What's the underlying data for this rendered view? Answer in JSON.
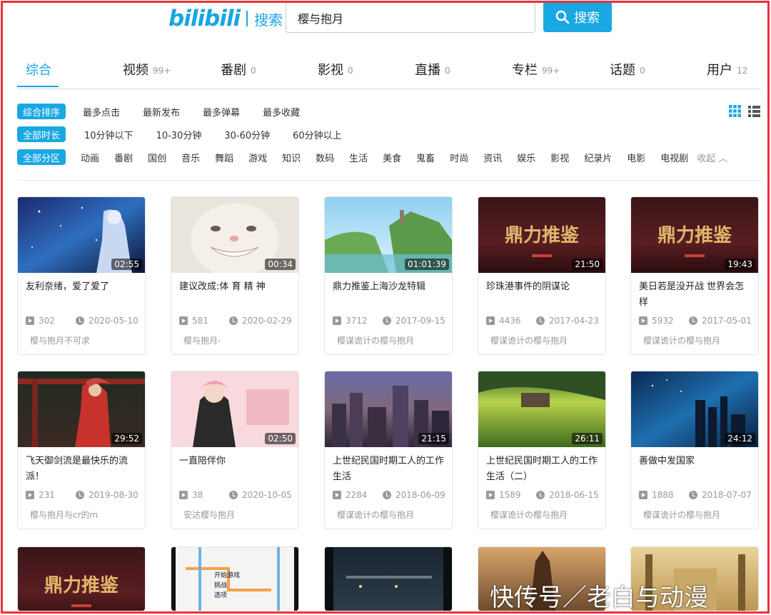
{
  "header": {
    "logo": "bilibili",
    "logo_suffix": "搜索",
    "search_value": "樱与抱月",
    "search_button": "搜索"
  },
  "tabs": [
    {
      "label": "综合",
      "count": ""
    },
    {
      "label": "视频",
      "count": "99+"
    },
    {
      "label": "番剧",
      "count": "0"
    },
    {
      "label": "影视",
      "count": "0"
    },
    {
      "label": "直播",
      "count": "0"
    },
    {
      "label": "专栏",
      "count": "99+"
    },
    {
      "label": "话题",
      "count": "0"
    },
    {
      "label": "用户",
      "count": "12"
    }
  ],
  "filters": {
    "sort": {
      "selected": "综合排序",
      "options": [
        "最多点击",
        "最新发布",
        "最多弹幕",
        "最多收藏"
      ]
    },
    "duration": {
      "selected": "全部时长",
      "options": [
        "10分钟以下",
        "10-30分钟",
        "30-60分钟",
        "60分钟以上"
      ]
    },
    "category": {
      "selected": "全部分区",
      "options": [
        "动画",
        "番剧",
        "国创",
        "音乐",
        "舞蹈",
        "游戏",
        "知识",
        "数码",
        "生活",
        "美食",
        "鬼畜",
        "时尚",
        "资讯",
        "娱乐",
        "影视",
        "纪录片",
        "电影",
        "电视剧"
      ],
      "collapse": "收起"
    }
  },
  "videos": [
    {
      "title": "友利奈绪，爱了爱了",
      "duration": "02:55",
      "plays": "302",
      "date": "2020-05-10",
      "uploader": "樱与抱月不可求",
      "thumb": "space"
    },
    {
      "title": "建议改成:体 育 精 神",
      "duration": "00:34",
      "plays": "581",
      "date": "2020-02-29",
      "uploader": "樱与抱月-",
      "thumb": "cat"
    },
    {
      "title": "鼎力推鉴上海沙龙特辑",
      "duration": "01:01:39",
      "plays": "3712",
      "date": "2017-09-15",
      "uploader": "樱谋诡计の樱与抱月",
      "thumb": "cliff"
    },
    {
      "title": "珍珠港事件的阴谋论",
      "duration": "21:50",
      "plays": "4436",
      "date": "2017-04-23",
      "uploader": "樱谋诡计の樱与抱月",
      "thumb": "dingli"
    },
    {
      "title": "美日若是没开战 世界会怎样",
      "duration": "19:43",
      "plays": "5932",
      "date": "2017-05-01",
      "uploader": "樱谋诡计の樱与抱月",
      "thumb": "dingli"
    },
    {
      "title": "飞天御剑流是最快乐的流派！",
      "duration": "29:52",
      "plays": "231",
      "date": "2019-08-30",
      "uploader": "樱与抱月与cr的m",
      "thumb": "samurai"
    },
    {
      "title": "一直陪伴你",
      "duration": "02:50",
      "plays": "38",
      "date": "2020-10-05",
      "uploader": "安达樱与抱月",
      "thumb": "pink"
    },
    {
      "title": "上世纪民国时期工人的工作生活",
      "duration": "21:15",
      "plays": "2284",
      "date": "2018-06-09",
      "uploader": "樱谋诡计の樱与抱月",
      "thumb": "city"
    },
    {
      "title": "上世纪民国时期工人的工作生活（二）",
      "duration": "26:11",
      "plays": "1589",
      "date": "2018-06-15",
      "uploader": "樱谋诡计の樱与抱月",
      "thumb": "field"
    },
    {
      "title": "善做中发国家",
      "duration": "24:12",
      "plays": "1888",
      "date": "2018-07-07",
      "uploader": "樱谋诡计の樱与抱月",
      "thumb": "night"
    }
  ],
  "partial_row": [
    {
      "thumb": "dingli",
      "overlay": ""
    },
    {
      "thumb": "map",
      "overlay": "开始游戏 挑战 选项"
    },
    {
      "thumb": "street",
      "overlay": ""
    },
    {
      "thumb": "tower",
      "overlay": ""
    },
    {
      "thumb": "temple",
      "overlay": ""
    }
  ],
  "partial_row_text": {
    "menu": [
      "开始游戏",
      "挑战",
      "选项"
    ],
    "brand": "鼎力推鉴"
  },
  "watermark": "快传号／老白与动漫",
  "colors": {
    "accent": "#1aa8e3",
    "frame": "#e8343a"
  }
}
